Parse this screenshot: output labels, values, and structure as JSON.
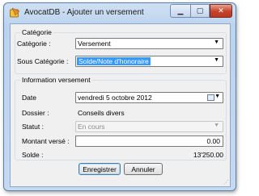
{
  "window": {
    "title": "AvocatDB - Ajouter un versement"
  },
  "titlebar": {
    "minimize_glyph": "▁",
    "maximize_glyph": "▢",
    "close_glyph": "✕"
  },
  "groups": {
    "categorie": {
      "title": "Catégorie",
      "categorie_label": "Catégorie :",
      "categorie_value": "Versement",
      "sous_categorie_label": "Sous Catégorie :",
      "sous_categorie_value": "Solde/Note d'honoraire"
    },
    "info": {
      "title": "Information versement",
      "date_label": "Date",
      "date_value": "vendredi    5  octobre  2012",
      "dossier_label": "Dossier :",
      "dossier_value": "Conseils divers",
      "statut_label": "Statut :",
      "statut_value": "En cours",
      "montant_label": "Montant versé :",
      "montant_value": "0.00",
      "solde_label": "Solde :",
      "solde_value": "13'250.00"
    }
  },
  "buttons": {
    "save": "Enregistrer",
    "cancel": "Annuler"
  },
  "icons": {
    "dropdown": "▼",
    "grip": "⋰"
  },
  "colors": {
    "selection": "#3399ff",
    "close_button": "#c5432b"
  }
}
